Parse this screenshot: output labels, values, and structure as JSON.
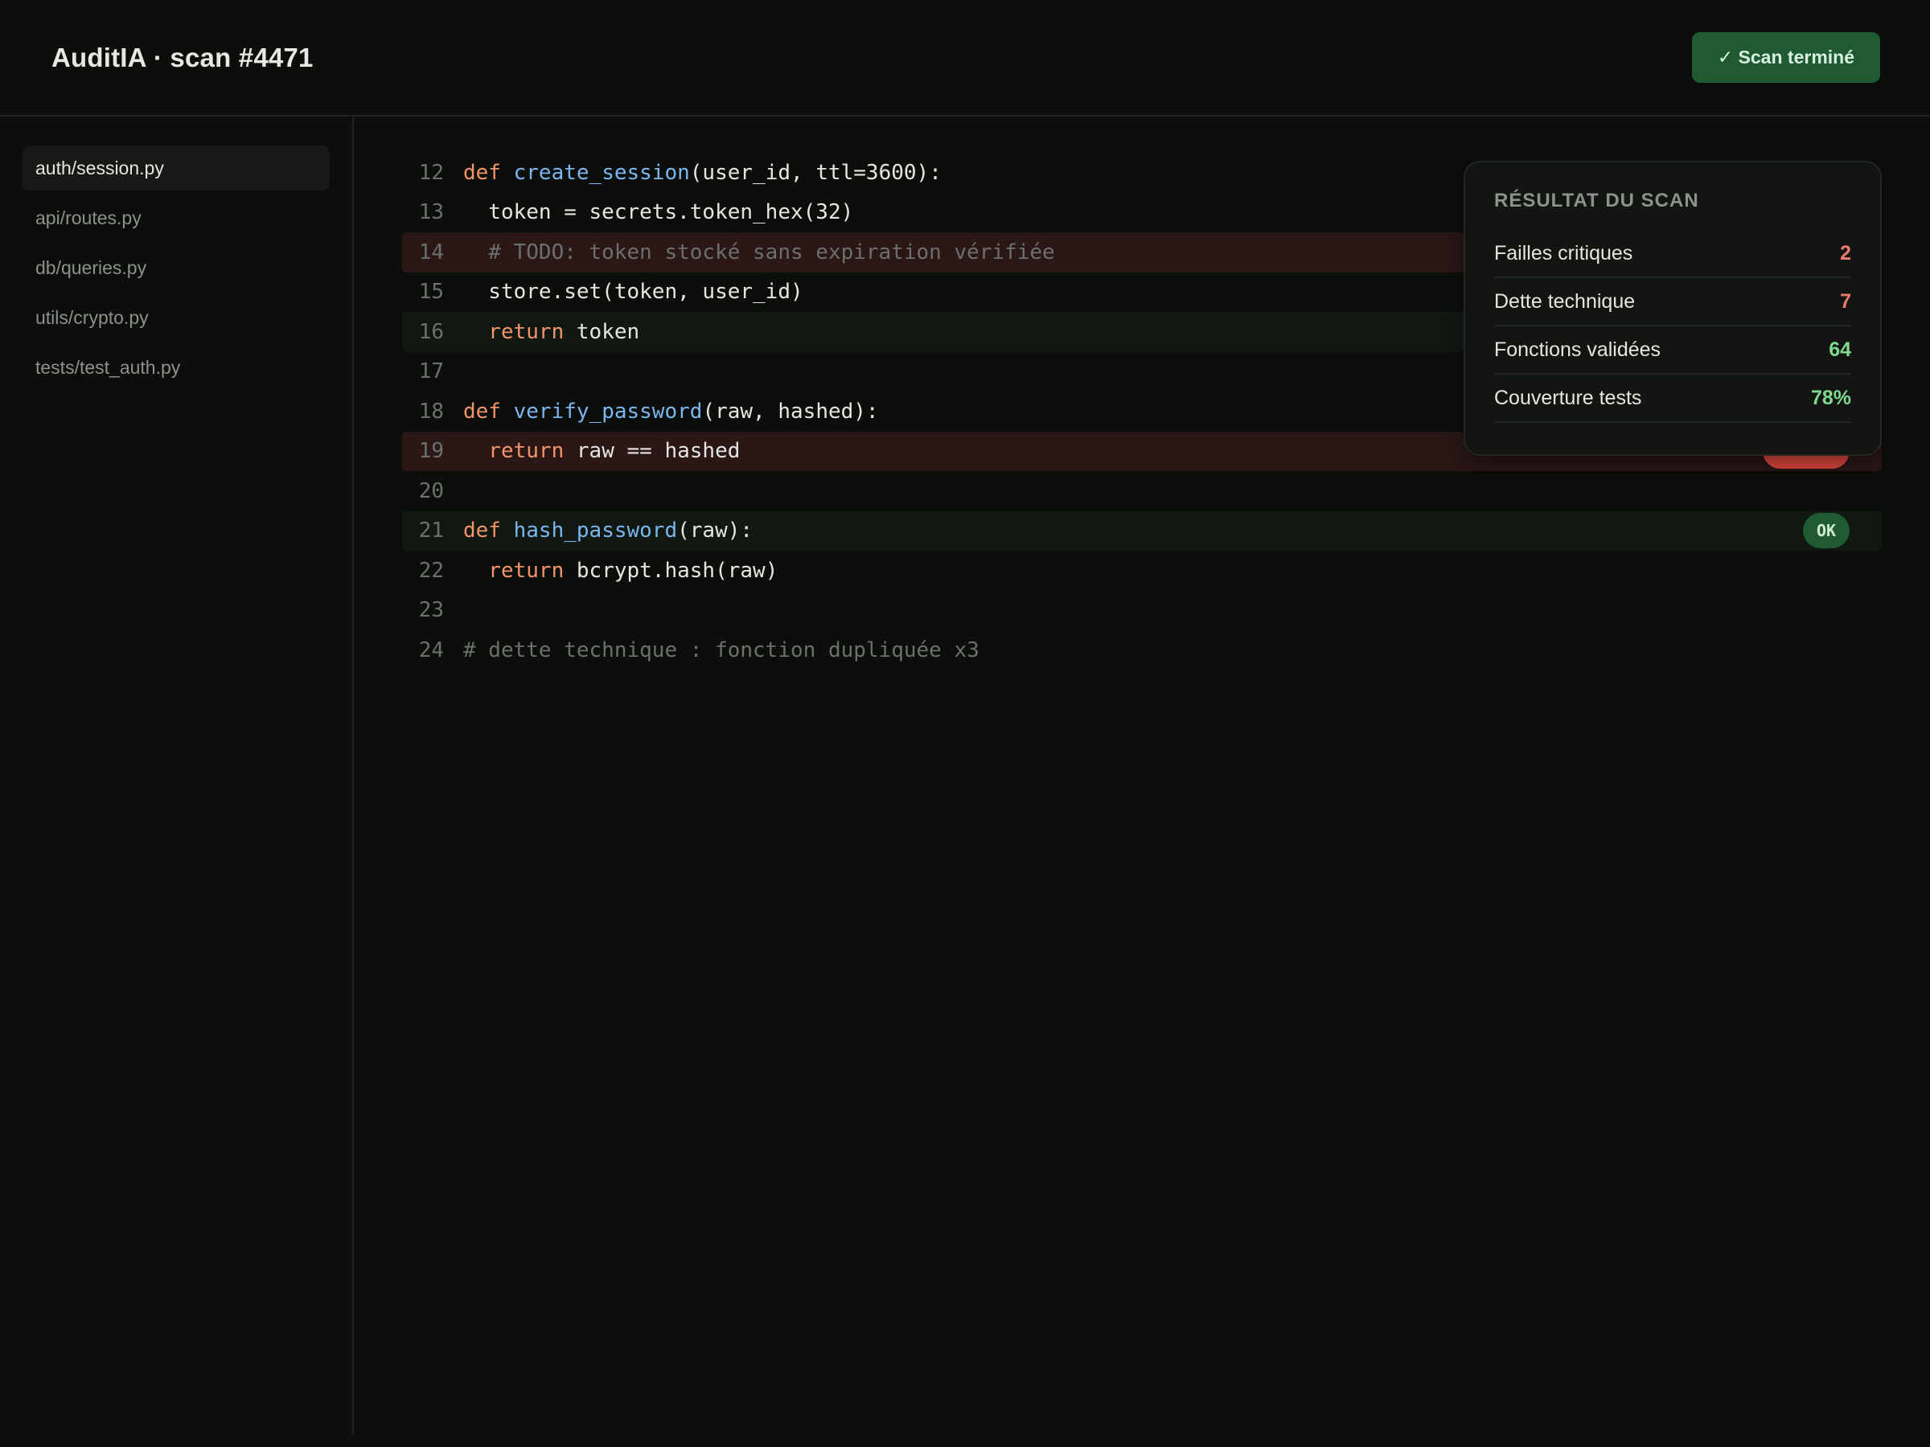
{
  "header": {
    "title": "AuditIA · scan #4471",
    "scan_status_label": "✓ Scan terminé"
  },
  "sidebar": {
    "files": [
      {
        "label": "auth/session.py",
        "active": true
      },
      {
        "label": "api/routes.py",
        "active": false
      },
      {
        "label": "db/queries.py",
        "active": false
      },
      {
        "label": "utils/crypto.py",
        "active": false
      },
      {
        "label": "tests/test_auth.py",
        "active": false
      }
    ]
  },
  "code": {
    "lines": [
      {
        "n": "12",
        "tokens": [
          [
            "kw",
            "def "
          ],
          [
            "fn",
            "create_session"
          ],
          [
            "tx",
            "(user_id, ttl=3600):"
          ]
        ]
      },
      {
        "n": "13",
        "tokens": [
          [
            "tx",
            "  token = secrets.token_hex(32)"
          ]
        ]
      },
      {
        "n": "14",
        "status": "critical",
        "tokens": [
          [
            "cm",
            "  # TODO: token stocké sans expiration vérifiée"
          ]
        ]
      },
      {
        "n": "15",
        "tokens": [
          [
            "tx",
            "  store.set(token, user_id)"
          ]
        ]
      },
      {
        "n": "16",
        "status": "ok",
        "tokens": [
          [
            "kw",
            "  return"
          ],
          [
            "tx",
            " token"
          ]
        ]
      },
      {
        "n": "17",
        "tokens": []
      },
      {
        "n": "18",
        "tokens": [
          [
            "kw",
            "def "
          ],
          [
            "fn",
            "verify_password"
          ],
          [
            "tx",
            "(raw, hashed):"
          ]
        ]
      },
      {
        "n": "19",
        "status": "critical",
        "badge": "",
        "tokens": [
          [
            "kw",
            "  return"
          ],
          [
            "tx",
            " raw == hashed"
          ]
        ]
      },
      {
        "n": "20",
        "tokens": []
      },
      {
        "n": "21",
        "status": "ok",
        "badge": "OK",
        "tokens": [
          [
            "kw",
            "def "
          ],
          [
            "fn",
            "hash_password"
          ],
          [
            "tx",
            "(raw):"
          ]
        ]
      },
      {
        "n": "22",
        "tokens": [
          [
            "kw",
            "  return"
          ],
          [
            "tx",
            " bcrypt.hash(raw)"
          ]
        ]
      },
      {
        "n": "23",
        "tokens": []
      },
      {
        "n": "24",
        "tokens": [
          [
            "cm",
            "# dette technique : fonction dupliquée x3"
          ]
        ]
      }
    ]
  },
  "scan_result": {
    "title": "RÉSULTAT DU SCAN",
    "metrics": [
      {
        "label": "Failles critiques",
        "value": "2",
        "tone": "red"
      },
      {
        "label": "Dette technique",
        "value": "7",
        "tone": "red"
      },
      {
        "label": "Fonctions validées",
        "value": "64",
        "tone": "green"
      },
      {
        "label": "Couverture tests",
        "value": "78%",
        "tone": "green"
      }
    ]
  },
  "colors": {
    "background": "#0c0e0c",
    "accent_green": "#1f5a33",
    "critical_red": "#e2493b",
    "keyword": "#f0956a",
    "function": "#7bb6ee",
    "comment": "#6c706a"
  }
}
